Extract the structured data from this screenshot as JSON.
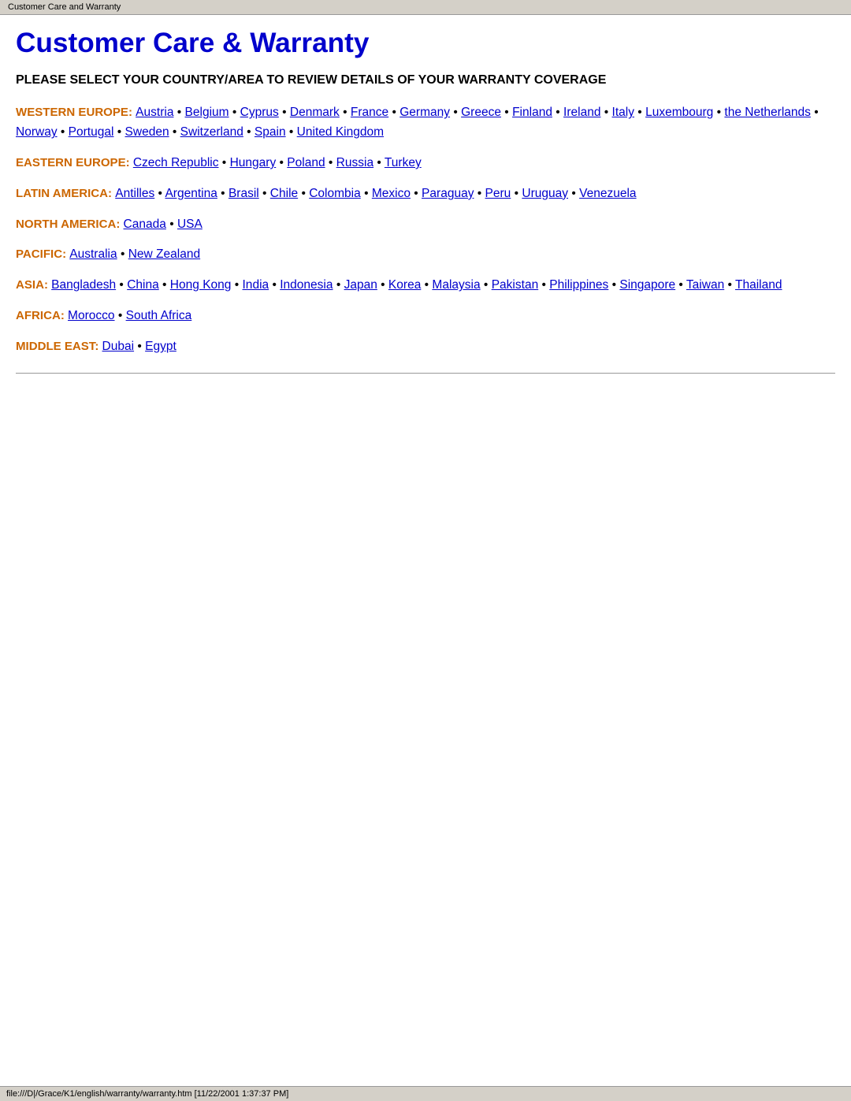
{
  "browser_tab": {
    "title": "Customer Care and Warranty"
  },
  "page": {
    "heading": "Customer Care & Warranty",
    "subtitle": "PLEASE SELECT YOUR COUNTRY/AREA TO REVIEW DETAILS OF YOUR WARRANTY COVERAGE"
  },
  "regions": [
    {
      "label": "WESTERN EUROPE:",
      "countries": [
        {
          "name": "Austria",
          "href": "#"
        },
        {
          "name": "Belgium",
          "href": "#"
        },
        {
          "name": "Cyprus",
          "href": "#"
        },
        {
          "name": "Denmark",
          "href": "#"
        },
        {
          "name": "France",
          "href": "#"
        },
        {
          "name": "Germany",
          "href": "#"
        },
        {
          "name": "Greece",
          "href": "#"
        },
        {
          "name": "Finland",
          "href": "#"
        },
        {
          "name": "Ireland",
          "href": "#"
        },
        {
          "name": "Italy",
          "href": "#"
        },
        {
          "name": "Luxembourg",
          "href": "#"
        },
        {
          "name": "the Netherlands",
          "href": "#"
        },
        {
          "name": "Norway",
          "href": "#"
        },
        {
          "name": "Portugal",
          "href": "#"
        },
        {
          "name": "Sweden",
          "href": "#"
        },
        {
          "name": "Switzerland",
          "href": "#"
        },
        {
          "name": "Spain",
          "href": "#"
        },
        {
          "name": "United Kingdom",
          "href": "#"
        }
      ]
    },
    {
      "label": "EASTERN EUROPE:",
      "countries": [
        {
          "name": "Czech Republic",
          "href": "#"
        },
        {
          "name": "Hungary",
          "href": "#"
        },
        {
          "name": "Poland",
          "href": "#"
        },
        {
          "name": "Russia",
          "href": "#"
        },
        {
          "name": "Turkey",
          "href": "#"
        }
      ]
    },
    {
      "label": "LATIN AMERICA:",
      "countries": [
        {
          "name": "Antilles",
          "href": "#"
        },
        {
          "name": "Argentina",
          "href": "#"
        },
        {
          "name": "Brasil",
          "href": "#"
        },
        {
          "name": "Chile",
          "href": "#"
        },
        {
          "name": "Colombia",
          "href": "#"
        },
        {
          "name": "Mexico",
          "href": "#"
        },
        {
          "name": "Paraguay",
          "href": "#"
        },
        {
          "name": "Peru",
          "href": "#"
        },
        {
          "name": "Uruguay",
          "href": "#"
        },
        {
          "name": "Venezuela",
          "href": "#"
        }
      ]
    },
    {
      "label": "NORTH AMERICA:",
      "countries": [
        {
          "name": "Canada",
          "href": "#"
        },
        {
          "name": "USA",
          "href": "#"
        }
      ]
    },
    {
      "label": "PACIFIC:",
      "countries": [
        {
          "name": "Australia",
          "href": "#"
        },
        {
          "name": "New Zealand",
          "href": "#"
        }
      ]
    },
    {
      "label": "ASIA:",
      "countries": [
        {
          "name": "Bangladesh",
          "href": "#"
        },
        {
          "name": "China",
          "href": "#"
        },
        {
          "name": "Hong Kong",
          "href": "#"
        },
        {
          "name": "India",
          "href": "#"
        },
        {
          "name": "Indonesia",
          "href": "#"
        },
        {
          "name": "Japan",
          "href": "#"
        },
        {
          "name": "Korea",
          "href": "#"
        },
        {
          "name": "Malaysia",
          "href": "#"
        },
        {
          "name": "Pakistan",
          "href": "#"
        },
        {
          "name": "Philippines",
          "href": "#"
        },
        {
          "name": "Singapore",
          "href": "#"
        },
        {
          "name": "Taiwan",
          "href": "#"
        },
        {
          "name": "Thailand",
          "href": "#"
        }
      ]
    },
    {
      "label": "AFRICA:",
      "countries": [
        {
          "name": "Morocco",
          "href": "#"
        },
        {
          "name": "South Africa",
          "href": "#"
        }
      ]
    },
    {
      "label": "MIDDLE EAST:",
      "countries": [
        {
          "name": "Dubai",
          "href": "#"
        },
        {
          "name": "Egypt",
          "href": "#"
        }
      ]
    }
  ],
  "status_bar": {
    "text": "file:///D|/Grace/K1/english/warranty/warranty.htm [11/22/2001 1:37:37 PM]"
  }
}
